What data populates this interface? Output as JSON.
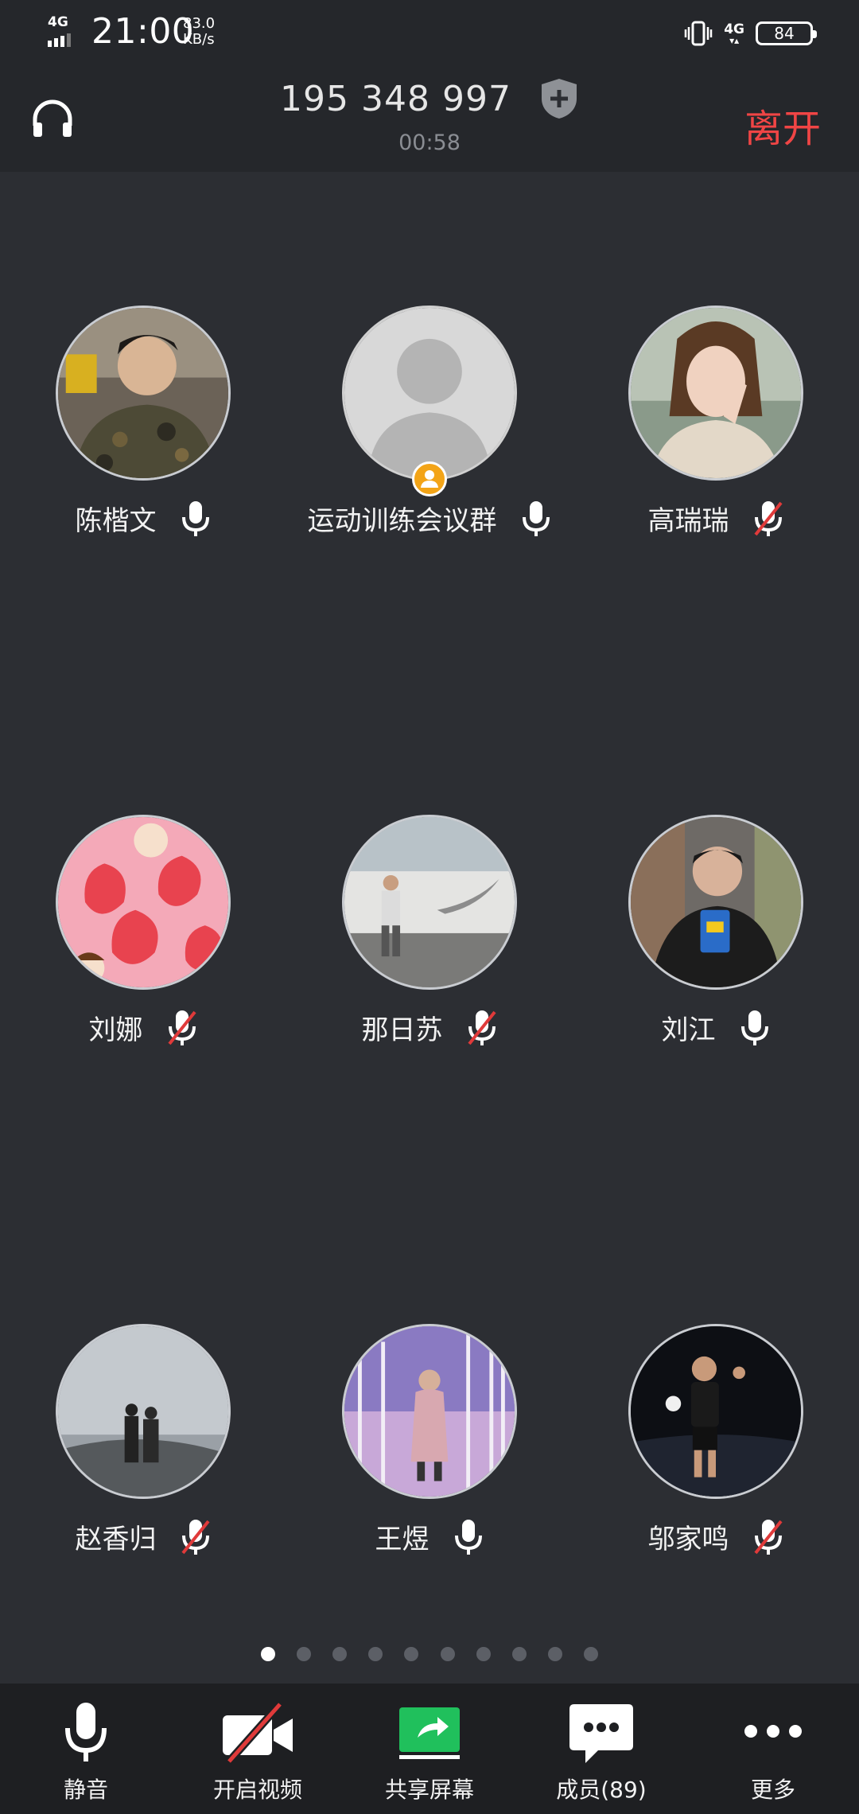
{
  "status_bar": {
    "network": "4G",
    "time": "21:00",
    "speed_value": "83.0",
    "speed_unit": "KB/s",
    "network_right": "4G",
    "battery": "84"
  },
  "header": {
    "meeting_id": "195 348 997",
    "timer": "00:58",
    "leave_label": "离开"
  },
  "participants": [
    {
      "name": "陈楷文",
      "muted": false,
      "avatar": "photo-man-camo-shirt"
    },
    {
      "name": "运动训练会议群",
      "muted": false,
      "avatar": "default-silhouette",
      "host": true
    },
    {
      "name": "高瑞瑞",
      "muted": true,
      "avatar": "photo-woman-selfie"
    },
    {
      "name": "刘娜",
      "muted": true,
      "avatar": "cartoon-strawberries"
    },
    {
      "name": "那日苏",
      "muted": true,
      "avatar": "photo-man-walking-nike-wall"
    },
    {
      "name": "刘江",
      "muted": false,
      "avatar": "photo-man-with-chips"
    },
    {
      "name": "赵香归",
      "muted": true,
      "avatar": "photo-couple-on-hill"
    },
    {
      "name": "王煜",
      "muted": false,
      "avatar": "photo-person-birch-forest"
    },
    {
      "name": "邬家鸣",
      "muted": true,
      "avatar": "photo-basketball-player"
    }
  ],
  "pagination": {
    "total": 10,
    "current": 1
  },
  "toolbar": {
    "mute_label": "静音",
    "video_label": "开启视频",
    "share_label": "共享屏幕",
    "members_label": "成员(89)",
    "more_label": "更多"
  },
  "colors": {
    "background": "#2c2e33",
    "header": "#25272b",
    "leave": "#f04545",
    "share_green": "#20c05c",
    "host_badge": "#f3a417",
    "muted_slash": "#e03a3a"
  }
}
